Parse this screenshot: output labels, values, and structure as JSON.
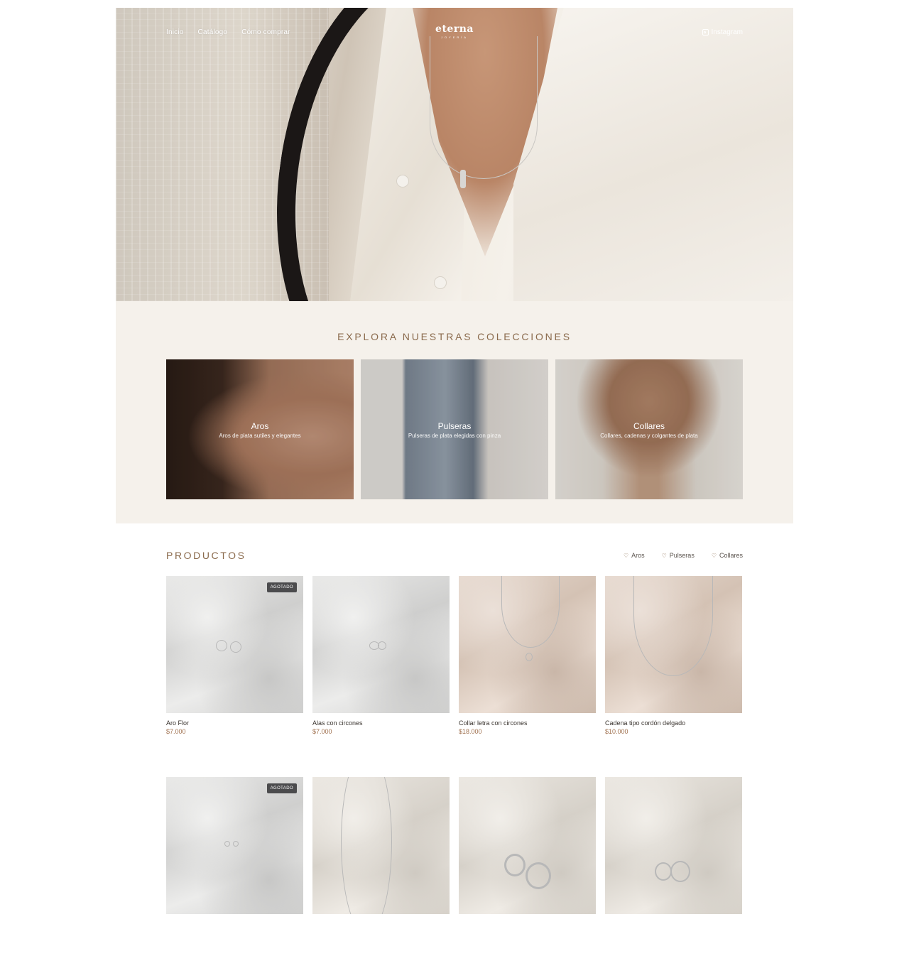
{
  "nav": {
    "links": [
      "Inicio",
      "Catálogo",
      "Cómo comprar"
    ],
    "logo": "eterna",
    "logo_sub": "JOYERÍA",
    "instagram": "Instagram"
  },
  "collections": {
    "heading": "EXPLORA NUESTRAS COLECCIONES",
    "items": [
      {
        "title": "Aros",
        "desc": "Aros de plata sutiles y elegantes"
      },
      {
        "title": "Pulseras",
        "desc": "Pulseras de plata elegidas con pinza"
      },
      {
        "title": "Collares",
        "desc": "Collares, cadenas y colgantes de plata"
      }
    ]
  },
  "products": {
    "heading": "PRODUCTOS",
    "filters": [
      "Aros",
      "Pulseras",
      "Collares"
    ],
    "sold_out_label": "AGOTADO",
    "items": [
      {
        "name": "Aro Flor",
        "price": "$7.000",
        "sold_out": true,
        "tone": "gray"
      },
      {
        "name": "Alas con circones",
        "price": "$7.000",
        "sold_out": false,
        "tone": "gray"
      },
      {
        "name": "Collar letra con circones",
        "price": "$18.000",
        "sold_out": false,
        "tone": "beige"
      },
      {
        "name": "Cadena tipo cordón delgado",
        "price": "$10.000",
        "sold_out": false,
        "tone": "beige"
      },
      {
        "name": "",
        "price": "",
        "sold_out": true,
        "tone": "gray"
      },
      {
        "name": "",
        "price": "",
        "sold_out": false,
        "tone": "cream"
      },
      {
        "name": "",
        "price": "",
        "sold_out": false,
        "tone": "cream"
      },
      {
        "name": "",
        "price": "",
        "sold_out": false,
        "tone": "cream"
      }
    ]
  },
  "colors": {
    "accent": "#8a6a4c",
    "price": "#a0714f",
    "section_bg": "#f5f1eb",
    "badge_bg": "#4b4b4d"
  }
}
